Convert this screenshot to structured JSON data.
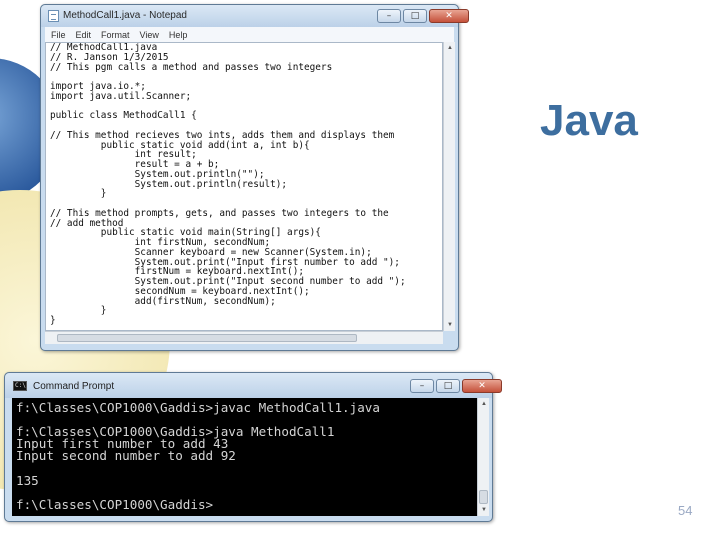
{
  "slide": {
    "title": "Java",
    "page_number": "54"
  },
  "notepad": {
    "window_title": "MethodCall1.java - Notepad",
    "menu": [
      "File",
      "Edit",
      "Format",
      "View",
      "Help"
    ],
    "buttons": {
      "minimize": "–",
      "maximize": "□",
      "close": "✕"
    },
    "code_lines": [
      "// MethodCall1.java",
      "// R. Janson 1/3/2015",
      "// This pgm calls a method and passes two integers",
      "",
      "import java.io.*;",
      "import java.util.Scanner;",
      "",
      "public class MethodCall1 {",
      "",
      "// This method recieves two ints, adds them and displays them",
      "         public static void add(int a, int b){",
      "               int result;",
      "               result = a + b;",
      "               System.out.println(\"\");",
      "               System.out.println(result);",
      "         }",
      "",
      "// This method prompts, gets, and passes two integers to the",
      "// add method",
      "         public static void main(String[] args){",
      "               int firstNum, secondNum;",
      "               Scanner keyboard = new Scanner(System.in);",
      "               System.out.print(\"Input first number to add \");",
      "               firstNum = keyboard.nextInt();",
      "               System.out.print(\"Input second number to add \");",
      "               secondNum = keyboard.nextInt();",
      "               add(firstNum, secondNum);",
      "         }",
      "}"
    ]
  },
  "cmd": {
    "window_title": "Command Prompt",
    "icon_text": "C:\\",
    "buttons": {
      "minimize": "–",
      "maximize": "□",
      "close": "✕"
    },
    "console_lines": [
      "f:\\Classes\\COP1000\\Gaddis>javac MethodCall1.java",
      "",
      "f:\\Classes\\COP1000\\Gaddis>java MethodCall1",
      "Input first number to add 43",
      "Input second number to add 92",
      "",
      "135",
      "",
      "f:\\Classes\\COP1000\\Gaddis>"
    ]
  }
}
